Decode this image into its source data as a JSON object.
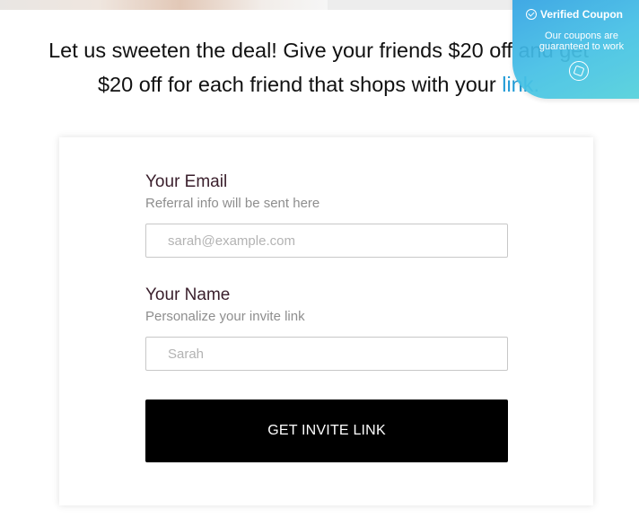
{
  "headline": {
    "text_before": "Let us sweeten the deal! Give your friends $20 off and get $20 off for each friend that shops with your ",
    "link_word": "link."
  },
  "coupon_badge": {
    "title": "Verified Coupon",
    "subtitle_line1": "Our coupons are",
    "subtitle_line2": "guaranteed to work",
    "brand_color": "#38b2e4"
  },
  "form": {
    "email": {
      "label": "Your Email",
      "hint": "Referral info will be sent here",
      "placeholder": "sarah@example.com",
      "value": ""
    },
    "name": {
      "label": "Your Name",
      "hint": "Personalize your invite link",
      "placeholder": "Sarah",
      "value": ""
    },
    "submit_label": "GET INVITE LINK"
  },
  "colors": {
    "button_bg": "#000000",
    "label_text": "#3a1f2c",
    "hint_text": "#8e8e8e"
  }
}
